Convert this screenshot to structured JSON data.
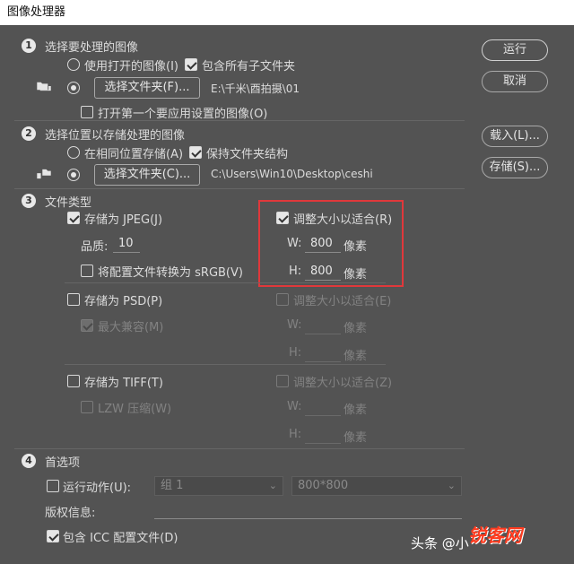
{
  "window": {
    "title": "图像处理器"
  },
  "buttons": {
    "run": "运行",
    "cancel": "取消",
    "load": "载入(L)...",
    "save": "存储(S)..."
  },
  "section1": {
    "num": "1",
    "title": "选择要处理的图像",
    "use_open": "使用打开的图像(I)",
    "include_sub": "包含所有子文件夹",
    "select_folder_btn": "选择文件夹(F)...",
    "folder_path": "E:\\千米\\酉拍摄\\01",
    "open_first": "打开第一个要应用设置的图像(O)"
  },
  "section2": {
    "num": "2",
    "title": "选择位置以存储处理的图像",
    "same_location": "在相同位置存储(A)",
    "keep_structure": "保持文件夹结构",
    "select_folder_btn": "选择文件夹(C)...",
    "folder_path": "C:\\Users\\Win10\\Desktop\\ceshi"
  },
  "section3": {
    "num": "3",
    "title": "文件类型",
    "jpeg": {
      "save_label": "存储为 JPEG(J)",
      "quality_label": "品质:",
      "quality_value": "10",
      "convert_srgb": "将配置文件转换为 sRGB(V)",
      "resize_label": "调整大小以适合(R)",
      "w_label": "W:",
      "w_value": "800",
      "w_unit": "像素",
      "h_label": "H:",
      "h_value": "800",
      "h_unit": "像素"
    },
    "psd": {
      "save_label": "存储为 PSD(P)",
      "max_compat": "最大兼容(M)",
      "resize_label": "调整大小以适合(E)",
      "w_label": "W:",
      "w_unit": "像素",
      "h_label": "H:",
      "h_unit": "像素"
    },
    "tiff": {
      "save_label": "存储为 TIFF(T)",
      "lzw": "LZW 压缩(W)",
      "resize_label": "调整大小以适合(Z)",
      "w_label": "W:",
      "w_unit": "像素",
      "h_label": "H:",
      "h_unit": "像素"
    }
  },
  "section4": {
    "num": "4",
    "title": "首选项",
    "run_action": "运行动作(U):",
    "action_set": "组 1",
    "action_name": "800*800",
    "copyright_label": "版权信息:",
    "include_icc": "包含 ICC 配置文件(D)"
  },
  "watermark": {
    "logo": "锐客网",
    "text": "头条 @小"
  },
  "colors": {
    "background": "#535353",
    "highlight": "#e0383b"
  }
}
